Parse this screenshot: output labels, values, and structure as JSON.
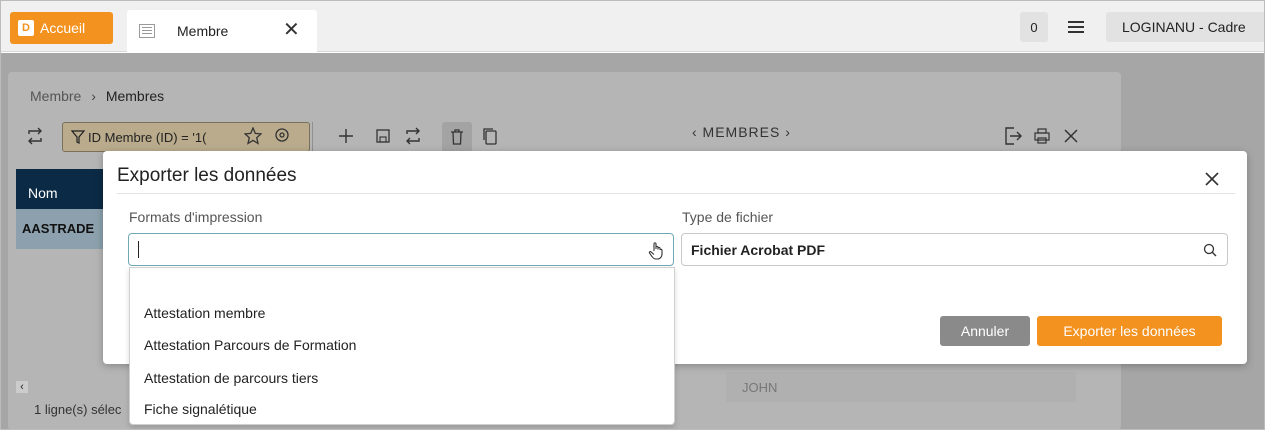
{
  "topbar": {
    "home_logo": "D",
    "home_label": "Accueil",
    "tab_label": "Membre",
    "tab_close": "✕",
    "counter": "0",
    "user_label": "LOGINANU - Cadre"
  },
  "page": {
    "breadcrumb_parent": "Membre",
    "breadcrumb_sep": "›",
    "breadcrumb_current": "Membres",
    "filter_label": "ID Membre (ID) = '1(",
    "nav_title": "‹ MEMBRES ›",
    "grid_header": "Nom",
    "grid_first_row": "AASTRADE",
    "selection_count": "1 ligne(s) sélec",
    "background_field": "JOHN"
  },
  "modal": {
    "title": "Exporter les données",
    "format_label": "Formats d'impression",
    "format_value": "",
    "filetype_label": "Type de fichier",
    "filetype_value": "Fichier Acrobat PDF",
    "cancel_label": "Annuler",
    "export_label": "Exporter les données"
  },
  "dropdown": {
    "options": [
      "Attestation membre",
      "Attestation Parcours de Formation",
      "Attestation de parcours tiers",
      "Fiche signalétique"
    ]
  },
  "colors": {
    "accent": "#f4921f",
    "grid_header": "#0b2a45",
    "cancel": "#8a8a8a"
  }
}
